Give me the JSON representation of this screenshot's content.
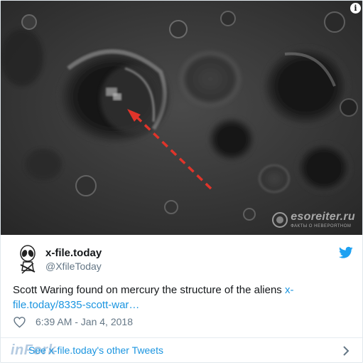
{
  "media": {
    "info_icon": "info-icon",
    "info_glyph": "i",
    "watermark_name": "esoreiter.ru",
    "watermark_tagline": "ФАКТЫ О НЕВЕРОЯТНОМ",
    "arrow_color": "#e0342a"
  },
  "tweet": {
    "author_name": "x-file.today",
    "author_handle": "@XfileToday",
    "text": "Scott Waring found on mercury the structure of the aliens ",
    "link_text": "x-file.today/8335-scott-war…",
    "timestamp": "6:39 AM - Jan 4, 2018",
    "like_icon": "heart-icon",
    "brand_icon": "twitter-bird-icon"
  },
  "footer": {
    "link_label": "See x-file.today's other Tweets",
    "watermark": "inFork",
    "chevron_icon": "chevron-right-icon"
  },
  "colors": {
    "link": "#1b95e0",
    "secondary_text": "#657786",
    "primary_text": "#14171a",
    "brand": "#1da1f2"
  }
}
